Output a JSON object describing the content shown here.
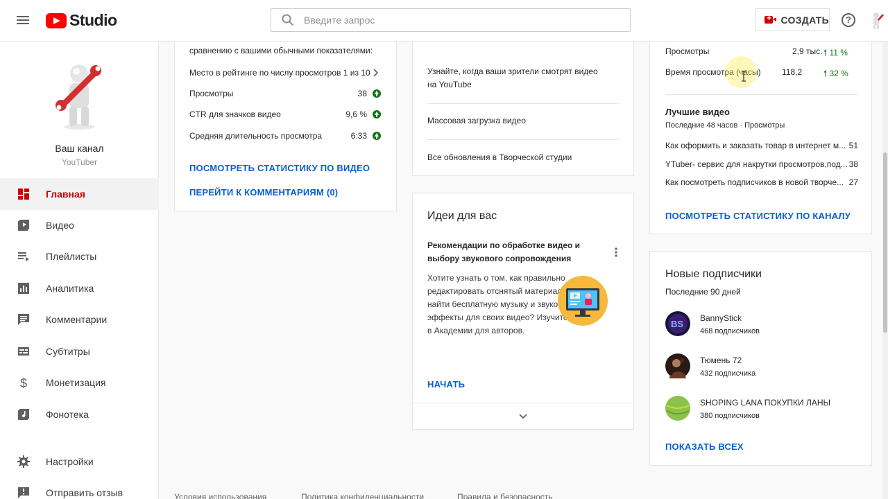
{
  "header": {
    "logo_text": "Studio",
    "search_placeholder": "Введите запрос",
    "create_label": "СОЗДАТЬ",
    "help_label": "?"
  },
  "sidebar": {
    "channel_name": "Ваш канал",
    "channel_subtitle": "YouTuber",
    "items": [
      {
        "label": "Главная",
        "icon": "dashboard-icon",
        "active": true
      },
      {
        "label": "Видео",
        "icon": "video-library-icon"
      },
      {
        "label": "Плейлисты",
        "icon": "playlist-icon"
      },
      {
        "label": "Аналитика",
        "icon": "analytics-icon"
      },
      {
        "label": "Комментарии",
        "icon": "comments-icon"
      },
      {
        "label": "Субтитры",
        "icon": "subtitles-icon"
      },
      {
        "label": "Монетизация",
        "icon": "dollar-icon"
      },
      {
        "label": "Фонотека",
        "icon": "audio-library-icon"
      },
      {
        "label": "Настройки",
        "icon": "gear-icon"
      },
      {
        "label": "Отправить отзыв",
        "icon": "feedback-icon"
      }
    ]
  },
  "video_card": {
    "intro": "сравнению с вашими обычными показателями:",
    "rank_label": "Место в рейтинге по числу просмотров 1 из 10",
    "metrics": [
      {
        "label": "Просмотры",
        "value": "38"
      },
      {
        "label": "CTR для значков видео",
        "value": "9,6 %"
      },
      {
        "label": "Средняя длительность просмотра",
        "value": "6:33"
      }
    ],
    "link_stats": "ПОСМОТРЕТЬ СТАТИСТИКУ ПО ВИДЕО",
    "link_comments": "ПЕРЕЙТИ К КОММЕНТАРИЯМ (0)"
  },
  "news_card": {
    "items": [
      "Узнайте, когда ваши зрители смотрят видео на YouTube",
      "Массовая загрузка видео",
      "Все обновления в Творческой студии"
    ]
  },
  "ideas_card": {
    "title": "Идеи для вас",
    "subtitle": "Рекомендации по обработке видео и выбору звукового сопровождения",
    "body": "Хотите узнать о том, как правильно редактировать отснятый материал и где найти бесплатную музыку и звуковые эффекты для своих видео? Изучите уроки в Академии для авторов.",
    "action": "НАЧАТЬ"
  },
  "analytics_card": {
    "rows": [
      {
        "label": "Просмотры",
        "value": "2,9 тыс.",
        "change": "11 %"
      },
      {
        "label": "Время просмотра (часы)",
        "value": "118,2",
        "change": "32 %"
      }
    ],
    "top_title": "Лучшие видео",
    "top_subtitle": "Последние 48 часов · Просмотры",
    "top_videos": [
      {
        "title": "Как оформить и заказать товар в интернет м...",
        "views": "51"
      },
      {
        "title": "YTuber- сервис для накрутки просмотров,под...",
        "views": "38"
      },
      {
        "title": "Как посмотреть подписчиков в новой творче...",
        "views": "27"
      }
    ],
    "link": "ПОСМОТРЕТЬ СТАТИСТИКУ ПО КАНАЛУ"
  },
  "subscribers_card": {
    "title": "Новые подписчики",
    "subtitle": "Последние 90 дней",
    "subscribers": [
      {
        "name": "BannyStick",
        "count": "468 подписчиков"
      },
      {
        "name": "Тюмень 72",
        "count": "432 подписчика"
      },
      {
        "name": "SHOPING LANA ПОКУПКИ ЛАНЫ",
        "count": "380 подписчиков"
      }
    ],
    "link": "ПОКАЗАТЬ ВСЕХ"
  },
  "footer": {
    "links": [
      "Условия использования",
      "Политика конфиденциальности",
      "Правила и безопасность"
    ]
  },
  "colors": {
    "brand_red": "#ff0000",
    "active_red": "#cc0000",
    "link_blue": "#065fd4",
    "positive_green": "#107516"
  }
}
